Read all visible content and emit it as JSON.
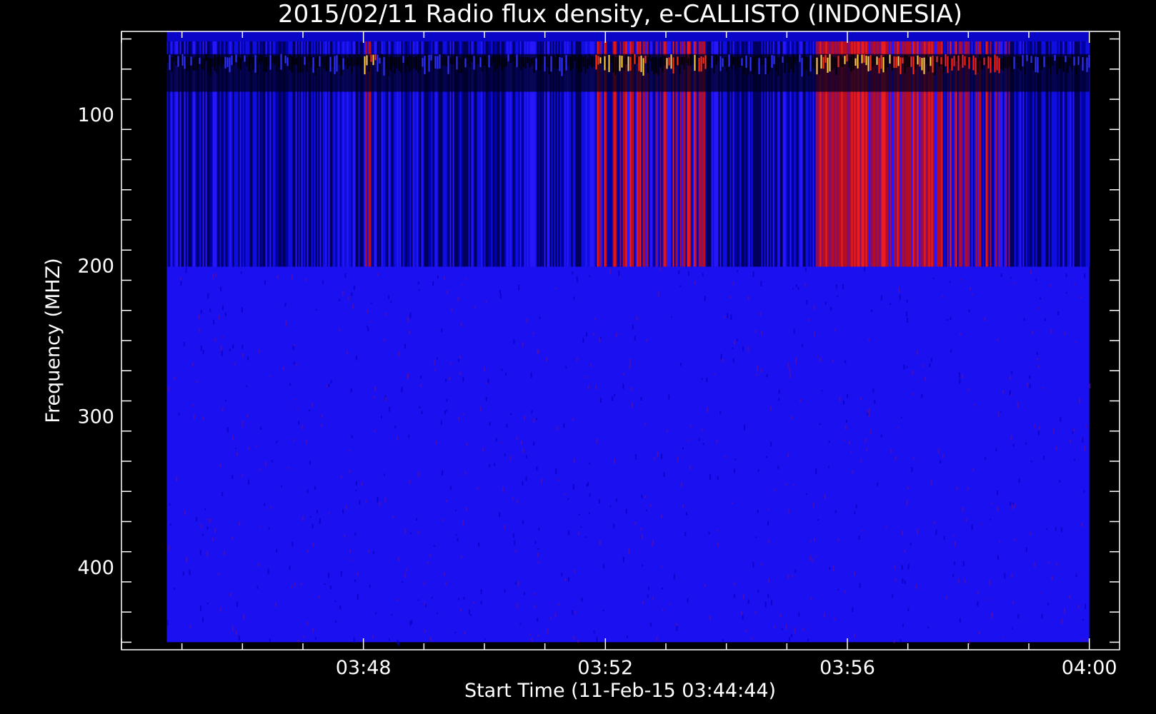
{
  "chart_data": {
    "type": "heatmap",
    "title": "2015/02/11  Radio flux density, e-CALLISTO (INDONESIA)",
    "xlabel": "Start Time (11-Feb-15 03:44:44)",
    "ylabel": "Frequency (MHZ)",
    "x_ticks": [
      "03:48",
      "03:52",
      "03:56",
      "04:00"
    ],
    "x_tick_minutes": [
      228,
      232,
      236,
      240
    ],
    "x_range_minutes": [
      224.0,
      240.5
    ],
    "data_x_range_minutes": [
      224.75,
      240.0
    ],
    "y_ticks": [
      100,
      200,
      300,
      400
    ],
    "y_range": [
      45,
      455
    ],
    "y_reversed": true,
    "data_y_range": [
      45,
      450
    ],
    "colormap": [
      "#000000",
      "#0000ff",
      "#ff0000",
      "#ffff00"
    ],
    "background_color": "#1a10f0",
    "features": {
      "active_band_mhz": [
        45,
        201
      ],
      "interference_band_mhz": [
        60,
        85
      ],
      "bursts": [
        {
          "start_time": "03:48:00",
          "end_time": "03:48:12",
          "intensity": 0.55
        },
        {
          "start_time": "03:51:50",
          "end_time": "03:53:40",
          "intensity": 0.6
        },
        {
          "start_time": "03:55:28",
          "end_time": "03:56:30",
          "intensity": 0.95
        },
        {
          "start_time": "03:56:30",
          "end_time": "03:57:30",
          "intensity": 0.8
        },
        {
          "start_time": "03:57:30",
          "end_time": "03:58:40",
          "intensity": 0.45
        }
      ]
    }
  }
}
